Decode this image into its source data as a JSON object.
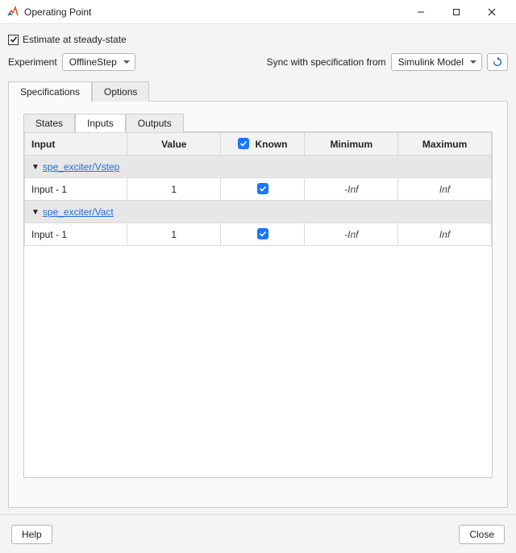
{
  "window": {
    "title": "Operating Point"
  },
  "options": {
    "estimate_steady_label": "Estimate at steady-state",
    "estimate_steady_checked": true
  },
  "experiment": {
    "label": "Experiment",
    "value": "OfflineStep"
  },
  "sync": {
    "label": "Sync with specification from",
    "value": "Simulink Model"
  },
  "outer_tabs": {
    "specifications": "Specifications",
    "options": "Options"
  },
  "inner_tabs": {
    "states": "States",
    "inputs": "Inputs",
    "outputs": "Outputs"
  },
  "table": {
    "headers": {
      "input": "Input",
      "value": "Value",
      "known": "Known",
      "minimum": "Minimum",
      "maximum": "Maximum"
    },
    "groups": [
      {
        "name": "spe_exciter/Vstep",
        "rows": [
          {
            "input": "Input - 1",
            "value": "1",
            "known": true,
            "min": "-Inf",
            "max": "Inf"
          }
        ]
      },
      {
        "name": "spe_exciter/Vact",
        "rows": [
          {
            "input": "Input - 1",
            "value": "1",
            "known": true,
            "min": "-Inf",
            "max": "Inf"
          }
        ]
      }
    ]
  },
  "footer": {
    "help": "Help",
    "close": "Close"
  }
}
